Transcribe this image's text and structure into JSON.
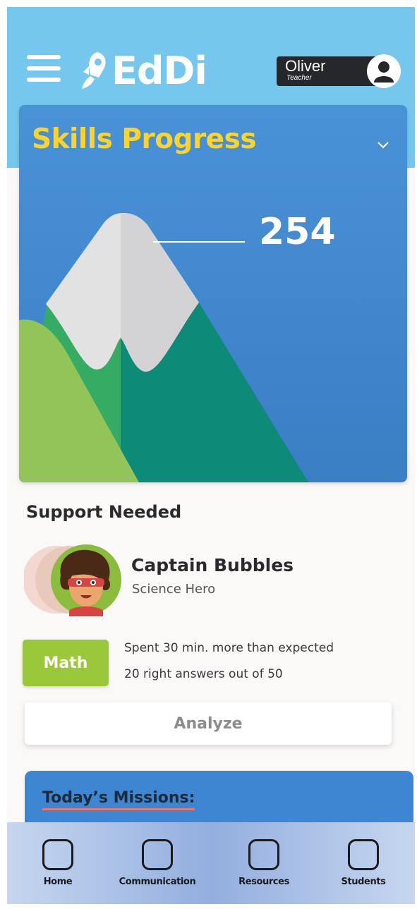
{
  "header": {
    "app_name": "EdDi",
    "user": {
      "name": "Oliver",
      "role": "Teacher"
    }
  },
  "skills": {
    "title": "Skills Progress",
    "score": "254"
  },
  "support": {
    "title": "Support Needed",
    "student": {
      "name": "Captain Bubbles",
      "role": "Science Hero"
    },
    "subject": "Math",
    "notes": [
      "Spent 30 min. more than expected",
      "20 right answers out of 50"
    ],
    "action_label": "Analyze"
  },
  "missions": {
    "title": "Today’s Missions:"
  },
  "nav": {
    "items": [
      {
        "label": "Home",
        "icon": "home-icon"
      },
      {
        "label": "Communication",
        "icon": "communication-icon"
      },
      {
        "label": "Resources",
        "icon": "resources-icon"
      },
      {
        "label": "Students",
        "icon": "students-icon"
      }
    ]
  },
  "colors": {
    "header_bg": "#76c7ee",
    "accent_yellow": "#fdd32c",
    "card_blue": "#4a92d8",
    "math_green": "#9bc83a",
    "underline_coral": "#e8796a"
  }
}
